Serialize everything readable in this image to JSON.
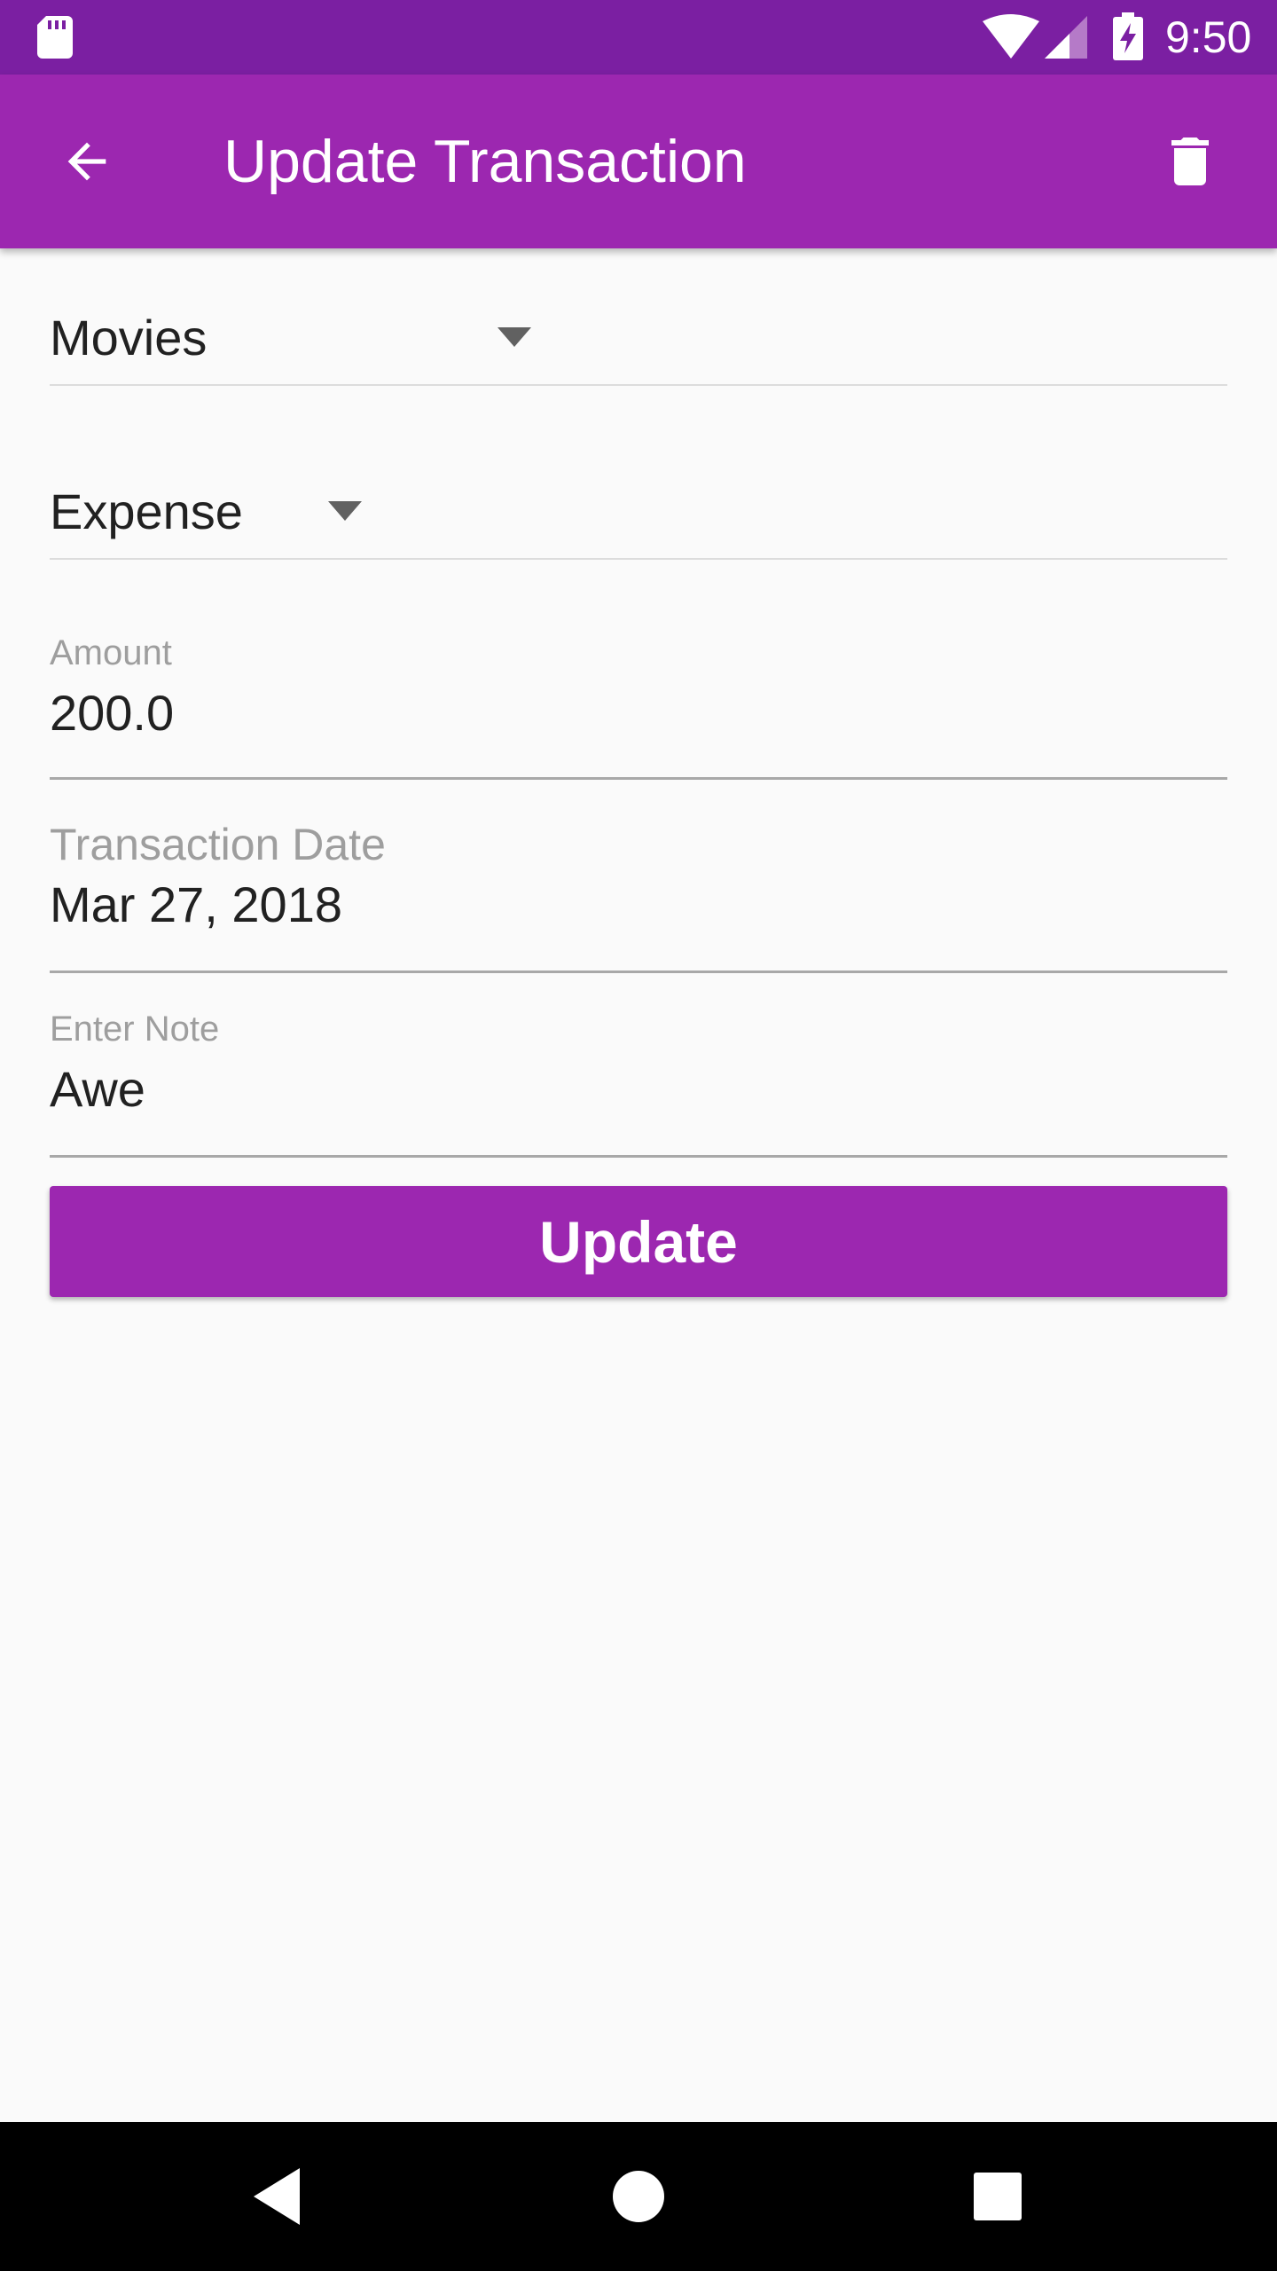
{
  "status_bar": {
    "time": "9:50",
    "icons": [
      "sd-card-icon",
      "wifi-icon",
      "signal-icon",
      "battery-charging-icon"
    ]
  },
  "app_bar": {
    "title": "Update Transaction",
    "back_icon": "arrow-back-icon",
    "delete_icon": "trash-icon"
  },
  "form": {
    "category": {
      "selected": "Movies"
    },
    "type": {
      "selected": "Expense"
    },
    "amount": {
      "label": "Amount",
      "value": "200.0"
    },
    "transaction_date": {
      "label": "Transaction Date",
      "value": "Mar 27, 2018"
    },
    "note": {
      "label": "Enter Note",
      "value": "Awe"
    },
    "update_label": "Update"
  },
  "nav_bar": {
    "icons": [
      "nav-back-icon",
      "nav-home-icon",
      "nav-recents-icon"
    ]
  },
  "colors": {
    "primary": "#9c27b0",
    "primary_dark": "#7b1fa2",
    "background": "#fafafa",
    "label_gray": "#9e9e9e"
  }
}
